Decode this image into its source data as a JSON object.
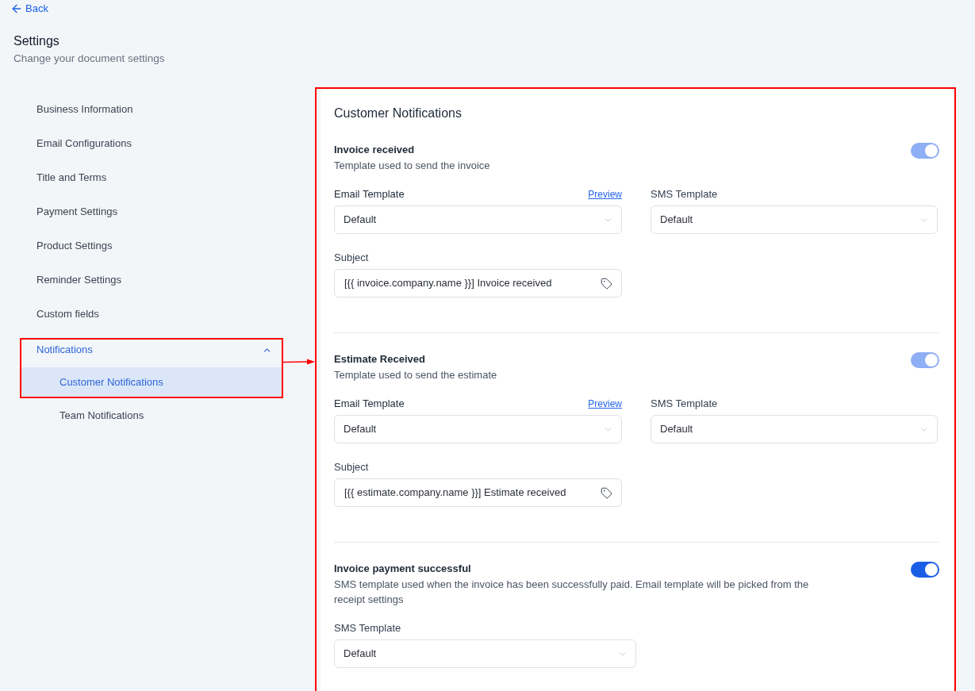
{
  "back_link": {
    "label": "Back"
  },
  "header": {
    "title": "Settings",
    "subtitle": "Change your document settings"
  },
  "sidebar": {
    "items": [
      {
        "label": "Business Information",
        "selected": false,
        "highlighted": false
      },
      {
        "label": "Email Configurations",
        "selected": false,
        "highlighted": false
      },
      {
        "label": "Title and Terms",
        "selected": false,
        "highlighted": false
      },
      {
        "label": "Payment Settings",
        "selected": false,
        "highlighted": false
      },
      {
        "label": "Product Settings",
        "selected": false,
        "highlighted": false
      },
      {
        "label": "Reminder Settings",
        "selected": false,
        "highlighted": false
      },
      {
        "label": "Custom fields",
        "selected": false,
        "highlighted": false
      },
      {
        "label": "Notifications",
        "selected": false,
        "highlighted": true,
        "expanded": true,
        "children": [
          {
            "label": "Customer Notifications",
            "selected": true,
            "highlighted": true
          },
          {
            "label": "Team Notifications",
            "selected": false,
            "highlighted": false
          }
        ]
      }
    ]
  },
  "panel": {
    "title": "Customer Notifications",
    "highlighted": true,
    "sections": [
      {
        "title": "Invoice received",
        "description": "Template used to send the invoice",
        "toggle": {
          "on": true,
          "disabled": true
        },
        "fields": [
          {
            "kind": "select",
            "label": "Email Template",
            "link": "Preview",
            "value": "Default"
          },
          {
            "kind": "select",
            "label": "SMS Template",
            "value": "Default"
          },
          {
            "kind": "text",
            "label": "Subject",
            "value": "[{{ invoice.company.name }}] Invoice received"
          }
        ]
      },
      {
        "title": "Estimate Received",
        "description": "Template used to send the estimate",
        "toggle": {
          "on": true,
          "disabled": true
        },
        "fields": [
          {
            "kind": "select",
            "label": "Email Template",
            "link": "Preview",
            "value": "Default"
          },
          {
            "kind": "select",
            "label": "SMS Template",
            "value": "Default"
          },
          {
            "kind": "text",
            "label": "Subject",
            "value": "[{{ estimate.company.name }}] Estimate received"
          }
        ]
      },
      {
        "title": "Invoice payment successful",
        "description": "SMS template used when the invoice has been successfully paid. Email template will be picked from the receipt settings",
        "toggle": {
          "on": true,
          "disabled": false
        },
        "fields": [
          {
            "kind": "select",
            "label": "SMS Template",
            "value": "Default"
          }
        ]
      }
    ]
  }
}
